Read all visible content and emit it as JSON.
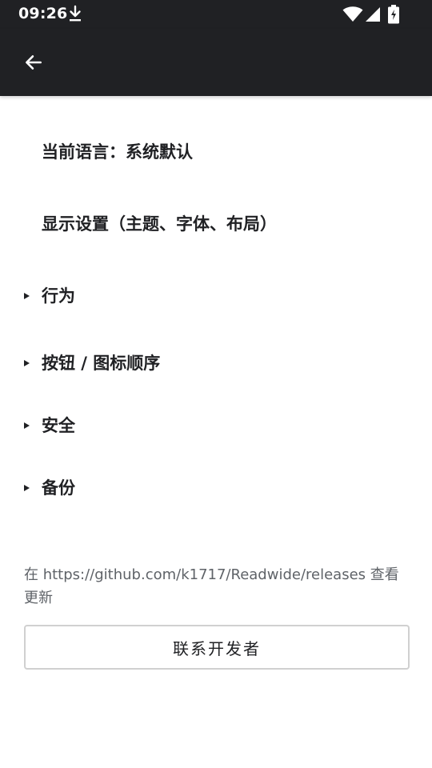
{
  "status_bar": {
    "time": "09:26",
    "icons": [
      "download-icon",
      "wifi-icon",
      "cellular-signal-icon",
      "battery-charging-icon"
    ]
  },
  "app_bar": {
    "back_icon": "arrow-back-icon"
  },
  "settings": {
    "language": "当前语言：系统默认",
    "display": "显示设置（主题、字体、布局）",
    "sections": [
      {
        "label": "行为",
        "icon": "expand-triangle-icon"
      },
      {
        "label": "按钮 / 图标顺序",
        "icon": "expand-triangle-icon"
      },
      {
        "label": "安全",
        "icon": "expand-triangle-icon"
      },
      {
        "label": "备份",
        "icon": "expand-triangle-icon"
      }
    ]
  },
  "update_info": "在 https://github.com/k1717/Readwide/releases 查看更新",
  "contact_button": "联系开发者",
  "colors": {
    "bar_background": "#202124",
    "text_primary": "#202124",
    "text_secondary": "#5f6368",
    "button_border": "#d0d0d0"
  }
}
